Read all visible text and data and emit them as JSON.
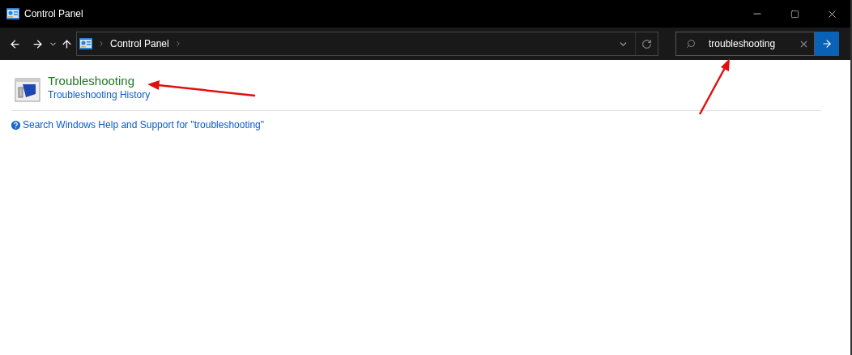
{
  "window": {
    "title": "Control Panel"
  },
  "address_bar": {
    "crumbs": [
      "Control Panel"
    ]
  },
  "search": {
    "value": "troubleshooting"
  },
  "results": [
    {
      "title": "Troubleshooting",
      "links": [
        "Troubleshooting History"
      ]
    }
  ],
  "help_link": "Search Windows Help and Support for \"troubleshooting\""
}
